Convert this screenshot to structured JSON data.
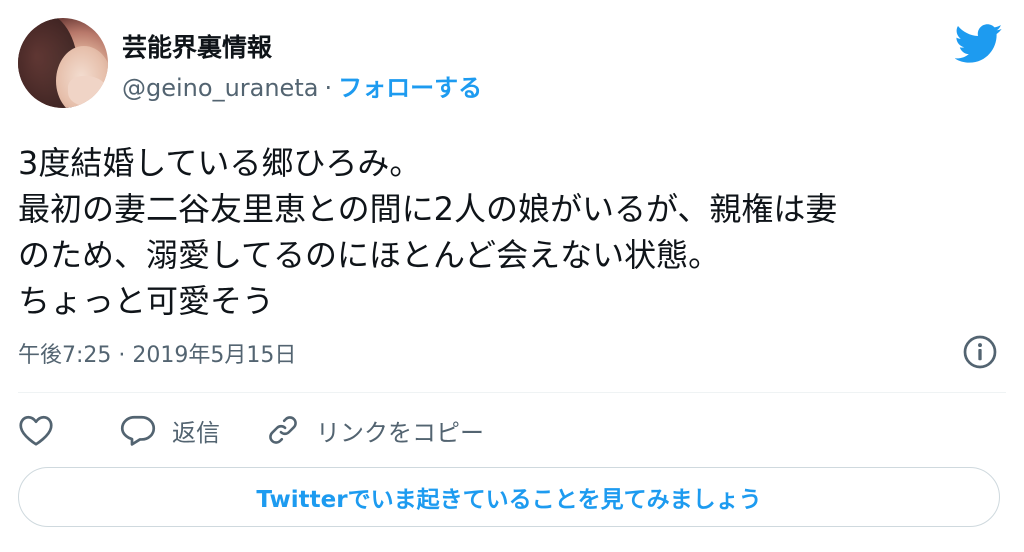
{
  "author": {
    "display_name": "芸能界裏情報",
    "handle": "@geino_uraneta",
    "separator": "·",
    "follow_label": "フォローする"
  },
  "tweet": {
    "lines": [
      "3度結婚している郷ひろみ。",
      "最初の妻二谷友里恵との間に2人の娘がいるが、親権は妻",
      "のため、溺愛してるのにほとんど会えない状態。",
      "ちょっと可愛そう"
    ],
    "timestamp": "午後7:25 · 2019年5月15日"
  },
  "actions": {
    "reply_label": "返信",
    "copy_link_label": "リンクをコピー"
  },
  "cta": {
    "label": "Twitterでいま起きていることを見てみましょう"
  },
  "icons": {
    "brand": "twitter-bird-icon",
    "info": "info-icon",
    "like": "heart-icon",
    "reply": "speech-bubble-icon",
    "link": "link-icon"
  },
  "colors": {
    "accent": "#1d9bf0",
    "text": "#0f1419",
    "muted": "#536471",
    "border": "#cfd9de"
  }
}
